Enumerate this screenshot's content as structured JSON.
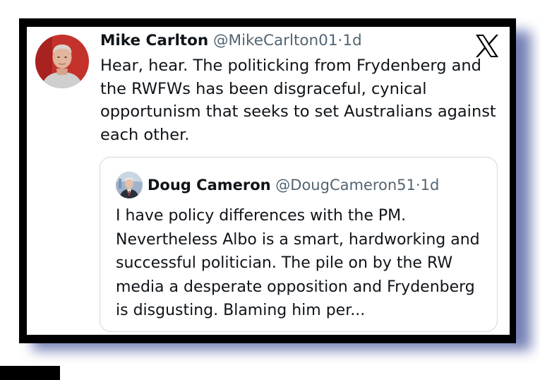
{
  "tweet": {
    "author_name": "Mike Carlton",
    "handle": "@MikeCarlton01",
    "separator": "·",
    "time": "1d",
    "text": "Hear, hear. The politicking from Frydenberg and the RWFWs has been disgraceful, cynical opportunism that seeks to set Australians against each other."
  },
  "quoted_tweet": {
    "author_name": "Doug Cameron",
    "handle": "@DougCameron51",
    "separator": "·",
    "time": "1d",
    "text": "I have policy differences with the PM. Nevertheless Albo is a smart, hardworking and successful politician. The pile on by the RW media a desperate opposition and Frydenberg is disgusting. Blaming him per..."
  },
  "icons": {
    "platform_logo": "x-logo-icon",
    "author_avatar": "avatar",
    "quoted_avatar": "avatar"
  },
  "colors": {
    "frame": "#000000",
    "shadow": "#5c6aa8",
    "text": "#0f1419",
    "meta": "#536471",
    "quote_border": "#cfd9de"
  }
}
